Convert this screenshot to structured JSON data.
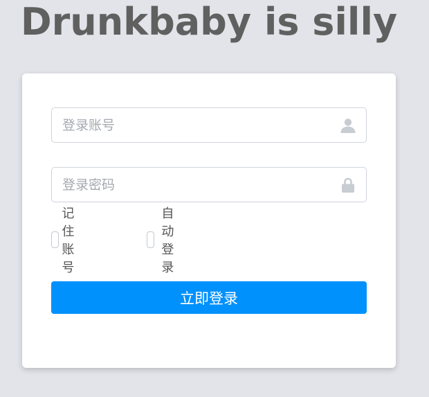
{
  "header": {
    "title": "Drunkbaby is silly"
  },
  "login_form": {
    "username": {
      "placeholder": "登录账号",
      "value": "",
      "icon": "user-icon"
    },
    "password": {
      "placeholder": "登录密码",
      "value": "",
      "icon": "lock-icon"
    },
    "remember_account": {
      "label": "记住账号",
      "checked": false
    },
    "auto_login": {
      "label": "自动登录",
      "checked": false
    },
    "submit_label": "立即登录"
  },
  "colors": {
    "background": "#e2e4e9",
    "title": "#606060",
    "primary_button": "#0091fd",
    "icon": "#c8ccd3"
  }
}
